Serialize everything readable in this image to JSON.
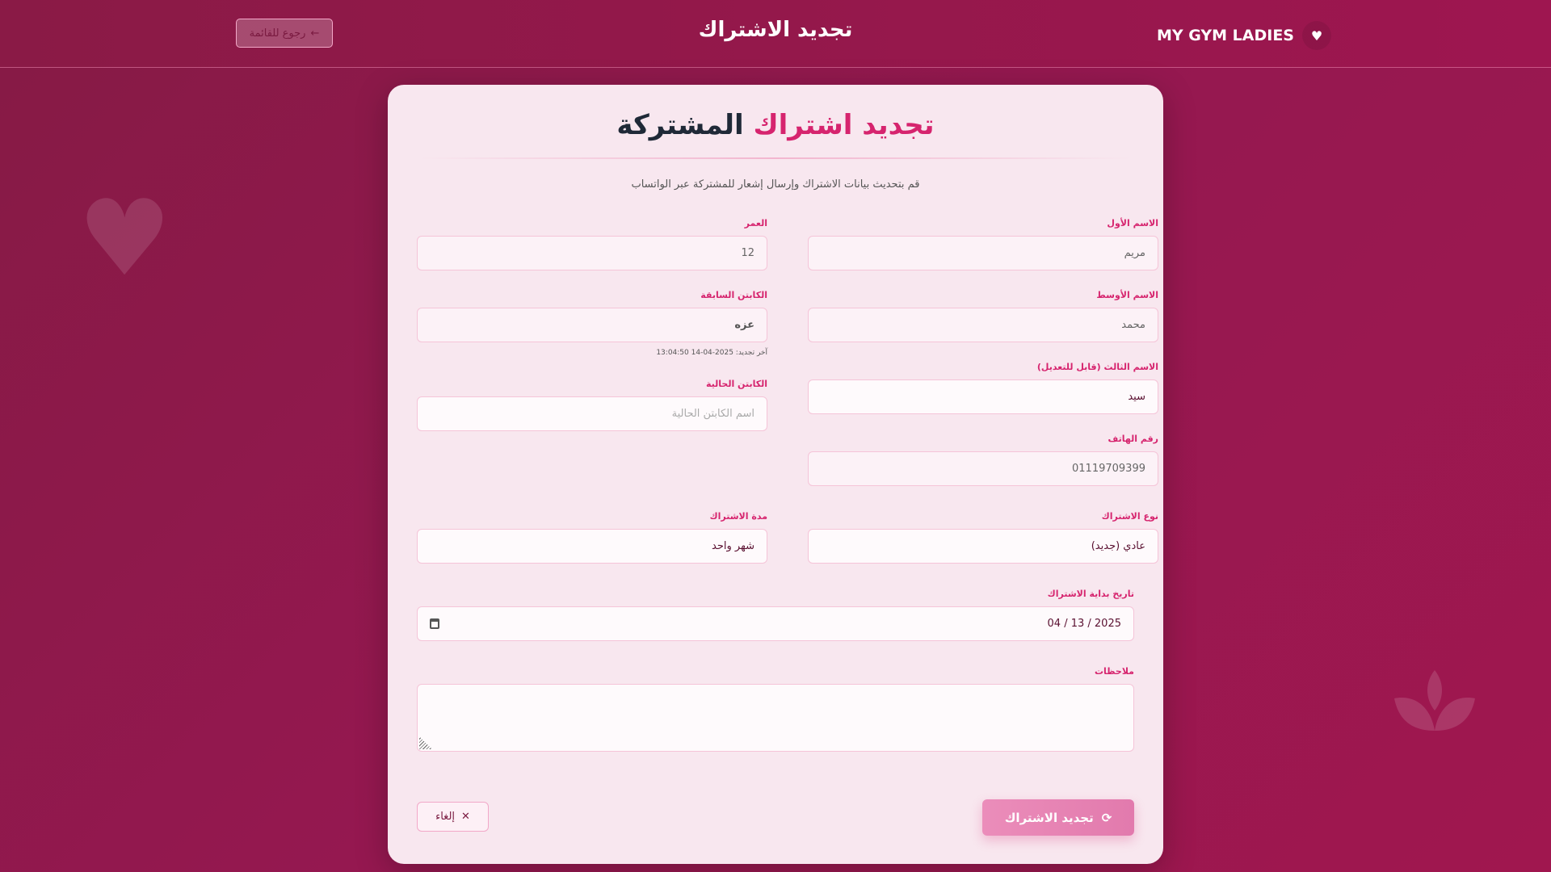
{
  "header": {
    "back_label": "رجوع للقائمة",
    "title": "تجديد الاشتراك",
    "brand": "MY GYM LADIES"
  },
  "card": {
    "title_part1": "تجديد اشتراك",
    "title_part2": "المشتركة",
    "subtitle": "قم بتحديث بيانات الاشتراك وإرسال إشعار للمشتركة عبر الواتساب"
  },
  "fields": {
    "first_name": {
      "label": "الاسم الأول",
      "value": "مريم"
    },
    "age": {
      "label": "العمر",
      "value": "12"
    },
    "middle_name": {
      "label": "الاسم الأوسط",
      "value": "محمد"
    },
    "previous_captain": {
      "label": "الكابتن السابقة",
      "value": "عزه",
      "note": "آخر تجديد: 2025-04-14 13:04:50"
    },
    "third_name": {
      "label": "الاسم الثالث (قابل للتعديل)",
      "value": "سيد"
    },
    "current_captain": {
      "label": "الكابتن الحالية",
      "placeholder": "اسم الكابتن الحالية"
    },
    "phone": {
      "label": "رقم الهاتف",
      "value": "01119709399"
    },
    "subscription_type": {
      "label": "نوع الاشتراك",
      "value": "عادي (جديد)"
    },
    "duration": {
      "label": "مدة الاشتراك",
      "value": "شهر واحد"
    },
    "start_date": {
      "label": "تاريخ بداية الاشتراك",
      "value": "04 / 13 / 2025"
    },
    "notes": {
      "label": "ملاحظات",
      "value": ""
    }
  },
  "actions": {
    "renew_label": "تجديد الاشتراك",
    "cancel_label": "إلغاء"
  },
  "colors": {
    "accent": "#d6246e",
    "bg": "#951850",
    "card": "#f8e7ef"
  }
}
